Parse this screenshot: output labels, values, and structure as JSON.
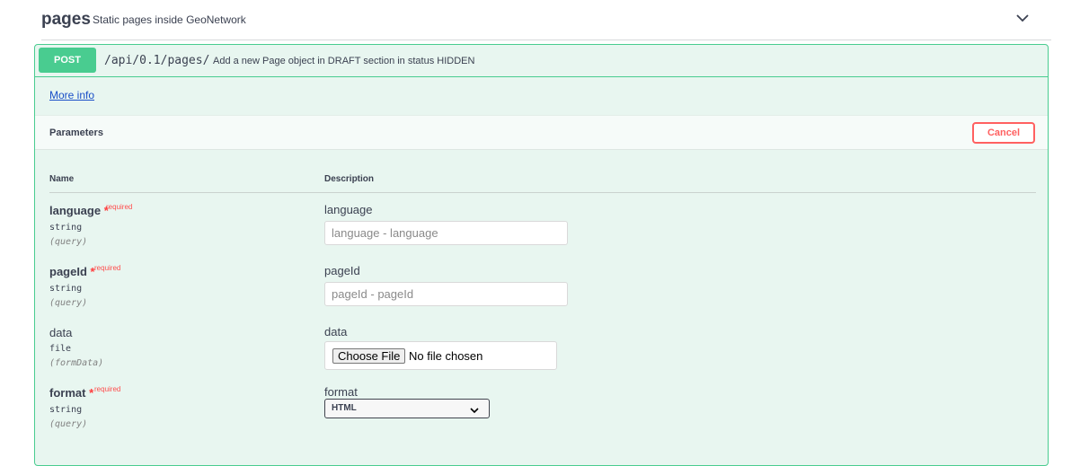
{
  "tag": {
    "name": "pages",
    "description": "Static pages inside GeoNetwork"
  },
  "operation": {
    "method": "POST",
    "path": "/api/0.1/pages/",
    "summary": "Add a new Page object in DRAFT section in status HIDDEN",
    "more_info": "More info"
  },
  "parameters_section": {
    "title": "Parameters",
    "cancel_label": "Cancel",
    "col_name": "Name",
    "col_description": "Description"
  },
  "params": [
    {
      "name": "language",
      "required_star": "*",
      "required_label": "required",
      "type": "string",
      "in": "(query)",
      "description": "language",
      "placeholder": "language - language"
    },
    {
      "name": "pageId",
      "required_star": "*",
      "required_label": "required",
      "type": "string",
      "in": "(query)",
      "description": "pageId",
      "placeholder": "pageId - pageId"
    },
    {
      "name": "data",
      "type": "file",
      "in": "(formData)",
      "description": "data",
      "file_button": "Choose File",
      "file_status": "No file chosen"
    },
    {
      "name": "format",
      "required_star": "*",
      "required_label": "required",
      "type": "string",
      "in": "(query)",
      "description": "format",
      "selected": "HTML"
    }
  ],
  "colors": {
    "post": "#49cc90",
    "post_bg": "#e8f6f0",
    "cancel": "#ff6060",
    "required": "#ff4d4d",
    "link": "#1a4fc8"
  },
  "icons": {
    "tag_toggle": "chevron-down-icon",
    "select_caret": "chevron-down-icon"
  }
}
